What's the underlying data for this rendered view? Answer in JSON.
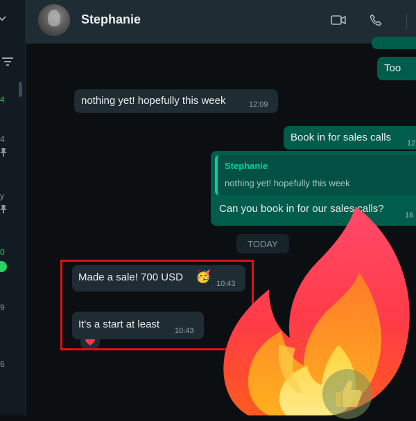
{
  "sidebar": {
    "items": [
      {
        "text": "4",
        "color": "#25d366"
      },
      {
        "text": "4"
      },
      {
        "text": "y"
      },
      {
        "text": "0",
        "color": "#25d366"
      },
      {
        "text": "9"
      },
      {
        "text": "6"
      }
    ]
  },
  "header": {
    "contact_name": "Stephanie",
    "icons": [
      "video-call-icon",
      "voice-call-icon"
    ]
  },
  "messages": {
    "m1": {
      "text": "Too"
    },
    "m2": {
      "text": "nothing yet! hopefully this week",
      "time": "12:09"
    },
    "m3": {
      "text": "Book in for sales calls",
      "time": "12"
    },
    "m4": {
      "reply_author": "Stephanie",
      "reply_text": "nothing yet! hopefully this week",
      "text": "Can you book in for our sales calls?",
      "time": "16"
    },
    "date_separator": "TODAY",
    "m5": {
      "text": "Made a sale! 700 USD",
      "emoji": "🥳",
      "time": "10:43",
      "reaction": "❤️"
    },
    "m6": {
      "text": "It's a start at least",
      "time": "10:43"
    }
  },
  "overlay": {
    "sticker": "fire-emoji",
    "icon": "thumbs-up-icon",
    "highlight_color": "#e0101a"
  },
  "colors": {
    "accent": "#25d366",
    "outgoing_bubble": "#005c4b",
    "incoming_bubble": "#202c33",
    "header": "#202c33"
  }
}
